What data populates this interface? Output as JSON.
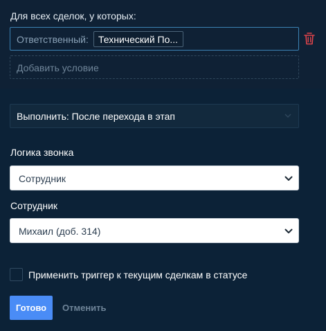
{
  "filter": {
    "title": "Для всех сделок, у которых:",
    "condition_label": "Ответственный:",
    "condition_value": "Технический По...",
    "add_condition": "Добавить условие"
  },
  "execute": {
    "label": "Выполнить: После перехода в этап"
  },
  "call_logic": {
    "label": "Логика звонка",
    "value": "Сотрудник"
  },
  "employee": {
    "label": "Сотрудник",
    "value": "Михаил (доб. 314)"
  },
  "apply_trigger": {
    "label": "Применить триггер к текущим сделкам в статусе",
    "checked": false
  },
  "actions": {
    "done": "Готово",
    "cancel": "Отменить"
  },
  "colors": {
    "primary_button": "#4a8cf6",
    "delete_icon": "#e0444b",
    "active_border": "#3c83b5"
  }
}
